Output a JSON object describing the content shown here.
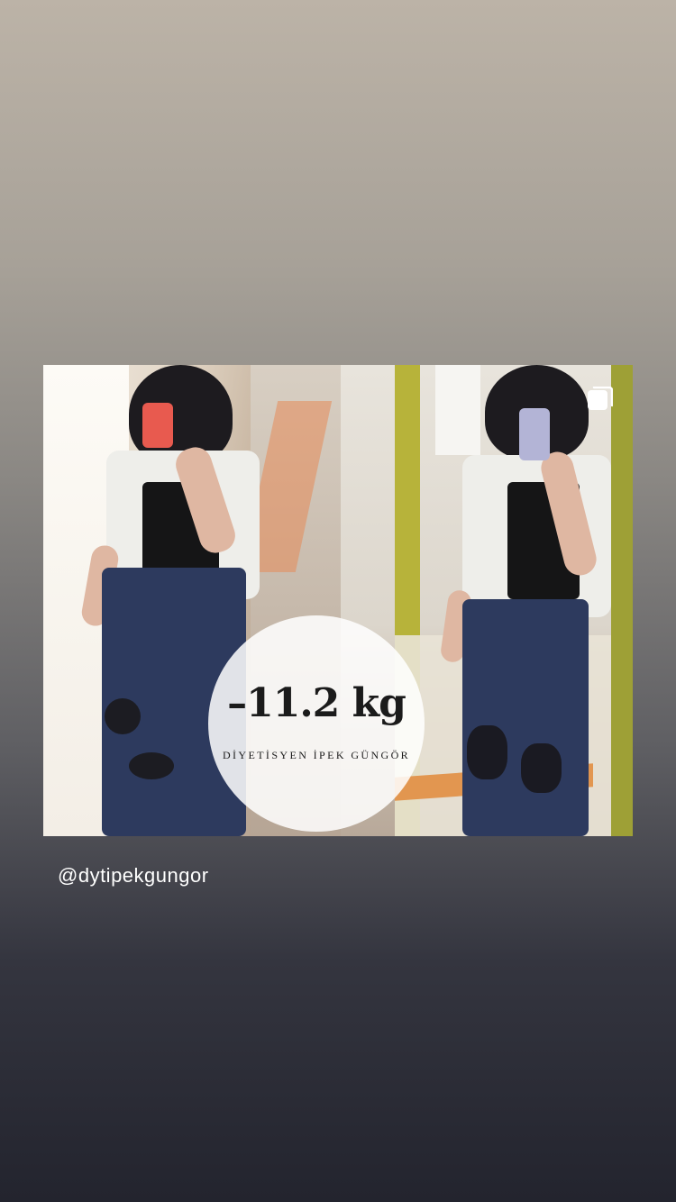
{
  "story": {
    "post_image": {
      "weight_loss_label": "–11.2 kg",
      "brand_label": "DİYETİSYEN İPEK GÜNGÖR",
      "collection_icon": "multiple-photos-icon"
    },
    "mention_sticker": "@dytipekgungor"
  },
  "colors": {
    "background_top": "#bcb3a7",
    "background_bottom": "#23242e",
    "phone_before": "#e85a4f",
    "phone_after": "#b3b4d6",
    "mirror_frame": "#b7b33a"
  }
}
